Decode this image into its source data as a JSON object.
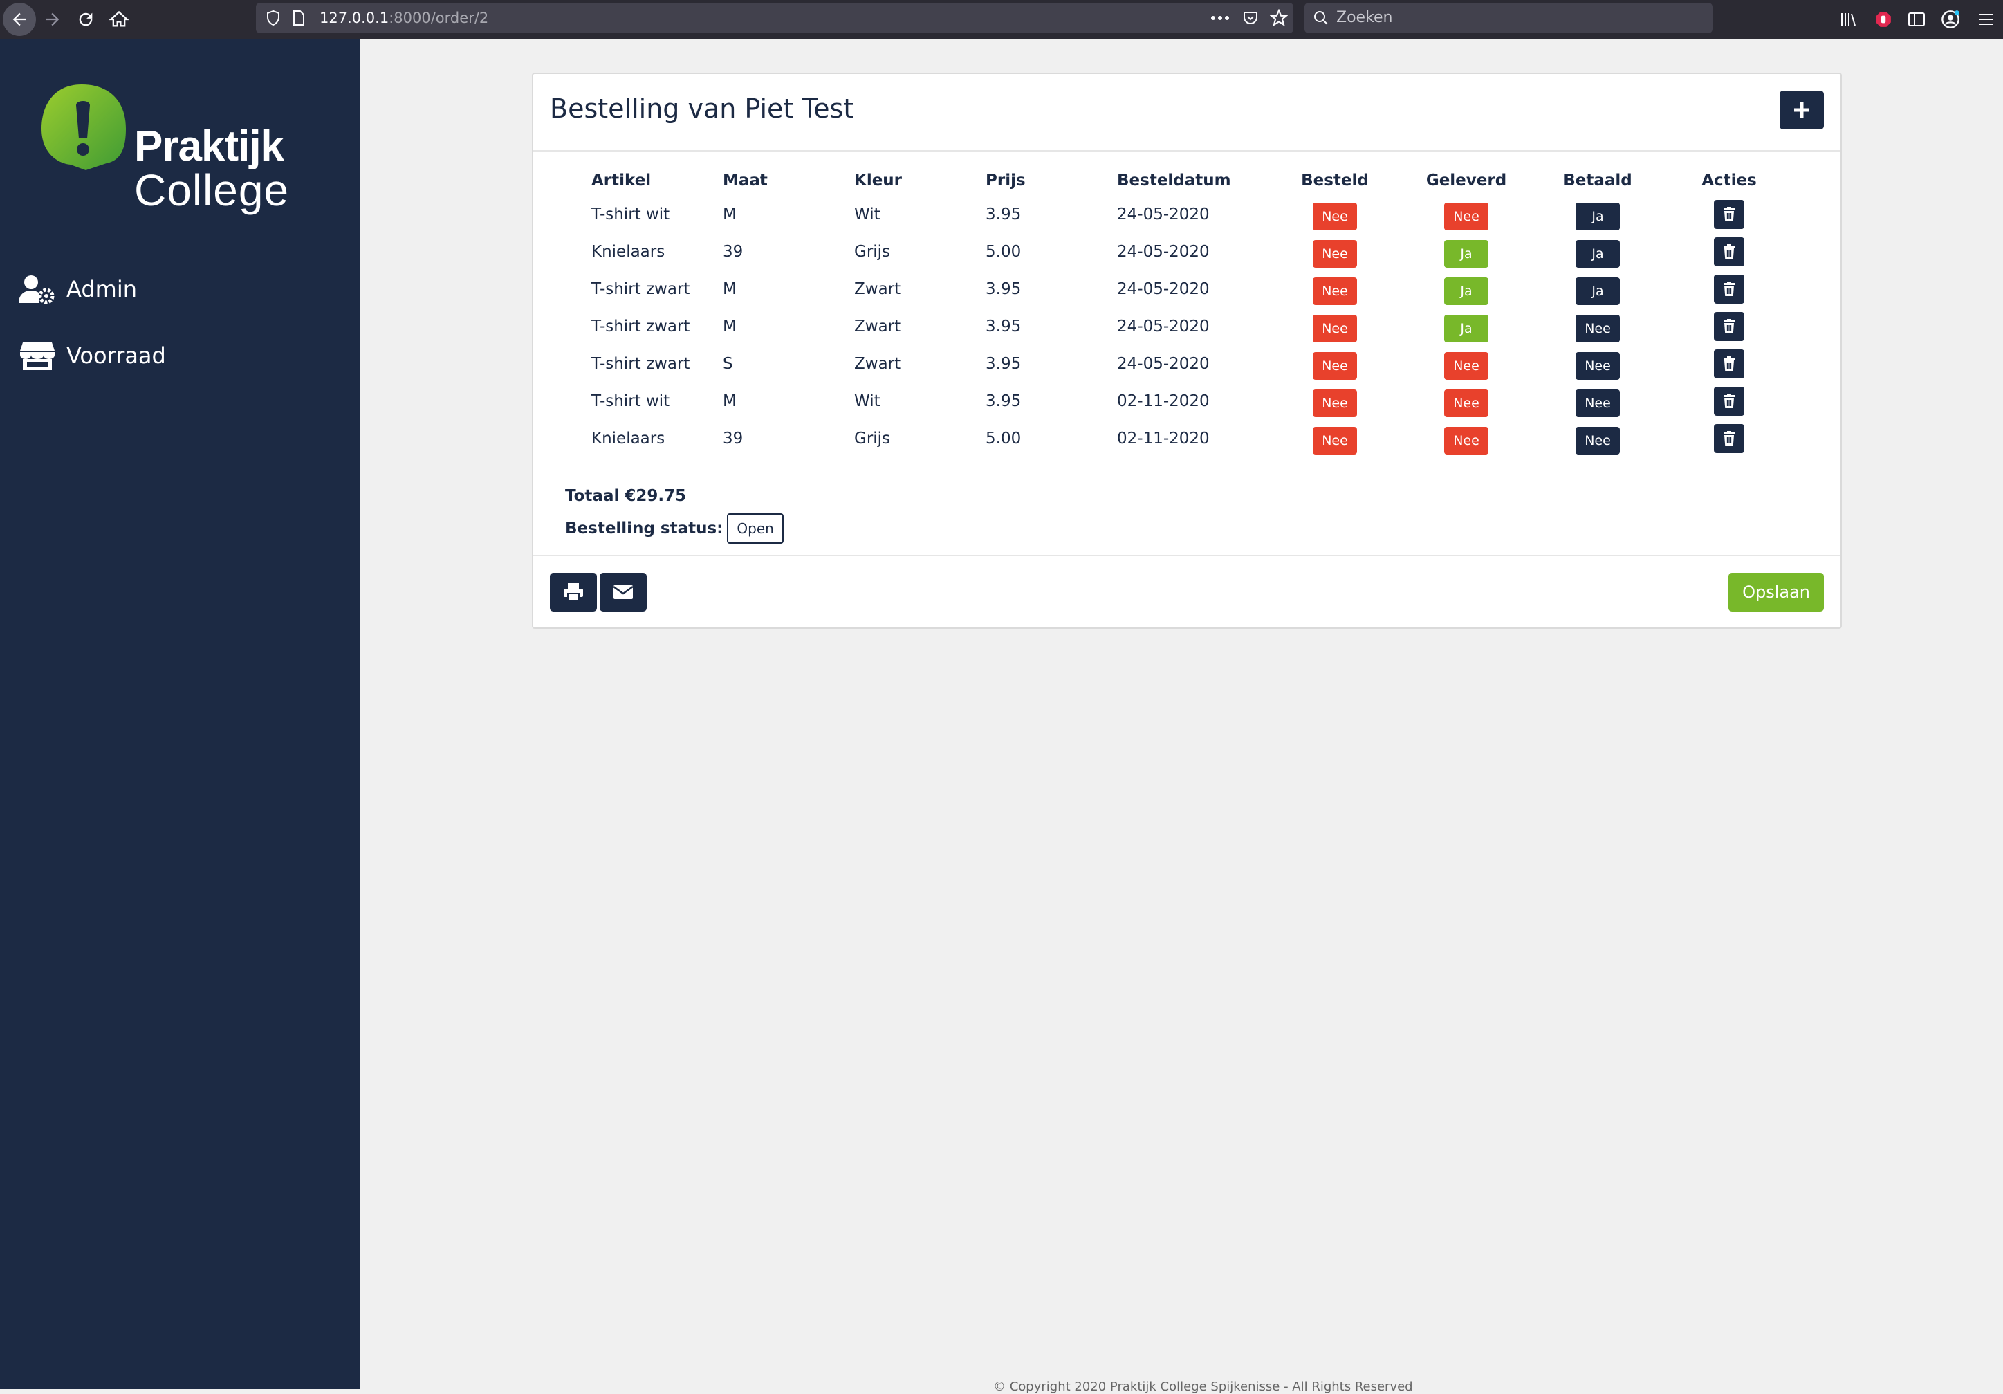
{
  "browser": {
    "url_host": "127.0.0.1",
    "url_path": ":8000/order/2",
    "search_placeholder": "Zoeken"
  },
  "sidebar": {
    "logo_line1": "Praktijk",
    "logo_line2": "College",
    "items": [
      {
        "label": "Admin",
        "icon": "user-cog-icon"
      },
      {
        "label": "Voorraad",
        "icon": "store-icon"
      }
    ]
  },
  "order": {
    "title": "Bestelling van Piet Test",
    "columns": [
      "Artikel",
      "Maat",
      "Kleur",
      "Prijs",
      "Besteldatum",
      "Besteld",
      "Geleverd",
      "Betaald",
      "Acties"
    ],
    "rows": [
      {
        "artikel": "T-shirt wit",
        "maat": "M",
        "kleur": "Wit",
        "prijs": "3.95",
        "datum": "24-05-2020",
        "besteld": "Nee",
        "geleverd": "Nee",
        "betaald": "Ja"
      },
      {
        "artikel": "Knielaars",
        "maat": "39",
        "kleur": "Grijs",
        "prijs": "5.00",
        "datum": "24-05-2020",
        "besteld": "Nee",
        "geleverd": "Ja",
        "betaald": "Ja"
      },
      {
        "artikel": "T-shirt zwart",
        "maat": "M",
        "kleur": "Zwart",
        "prijs": "3.95",
        "datum": "24-05-2020",
        "besteld": "Nee",
        "geleverd": "Ja",
        "betaald": "Ja"
      },
      {
        "artikel": "T-shirt zwart",
        "maat": "M",
        "kleur": "Zwart",
        "prijs": "3.95",
        "datum": "24-05-2020",
        "besteld": "Nee",
        "geleverd": "Ja",
        "betaald": "Nee"
      },
      {
        "artikel": "T-shirt zwart",
        "maat": "S",
        "kleur": "Zwart",
        "prijs": "3.95",
        "datum": "24-05-2020",
        "besteld": "Nee",
        "geleverd": "Nee",
        "betaald": "Nee"
      },
      {
        "artikel": "T-shirt wit",
        "maat": "M",
        "kleur": "Wit",
        "prijs": "3.95",
        "datum": "02-11-2020",
        "besteld": "Nee",
        "geleverd": "Nee",
        "betaald": "Nee"
      },
      {
        "artikel": "Knielaars",
        "maat": "39",
        "kleur": "Grijs",
        "prijs": "5.00",
        "datum": "02-11-2020",
        "besteld": "Nee",
        "geleverd": "Nee",
        "betaald": "Nee"
      }
    ],
    "total_label": "Totaal €29.75",
    "status_label": "Bestelling status:",
    "status_value": "Open",
    "save_label": "Opslaan"
  },
  "footer": {
    "copyright": "© Copyright 2020 Praktijk College Spijkenisse - All Rights Reserved"
  },
  "colors": {
    "navy": "#1c2a44",
    "red": "#e8412c",
    "green": "#78b82a",
    "betaald_ja": "#1c2a44",
    "betaald_nee": "#1c2a44"
  }
}
